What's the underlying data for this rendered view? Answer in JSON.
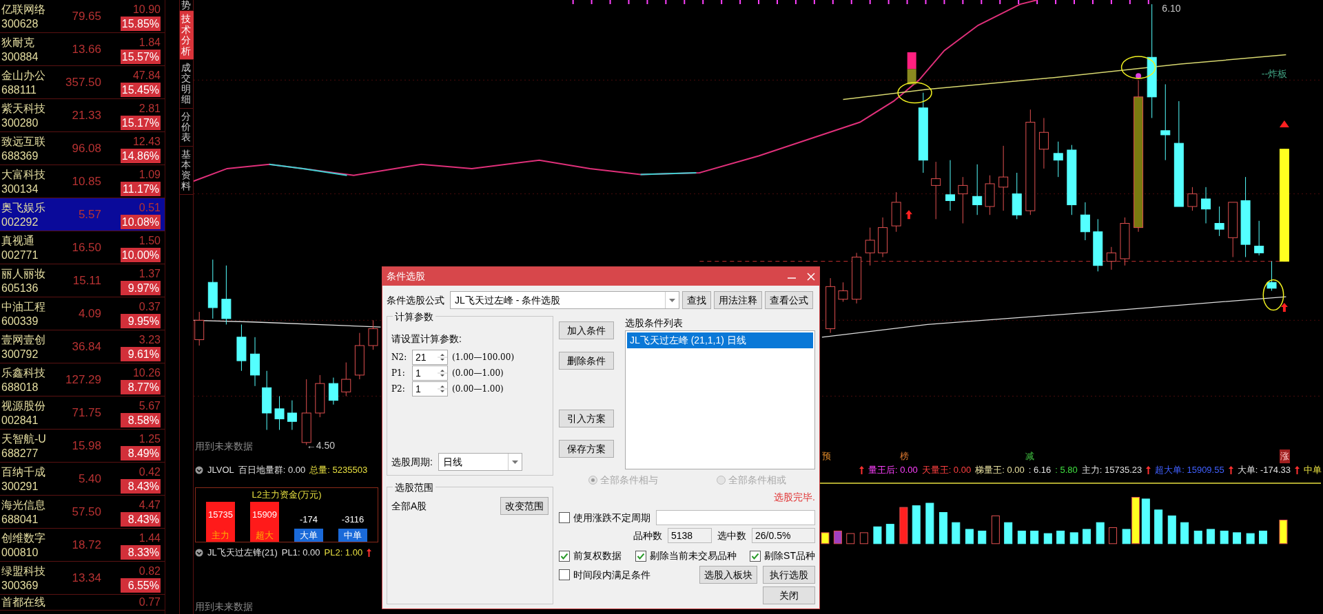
{
  "stock_list": [
    {
      "name": "亿联网络",
      "code": "300628",
      "price": "79.65",
      "change": "10.90",
      "change_pct": "15.85%",
      "selected": false
    },
    {
      "name": "狄耐克",
      "code": "300884",
      "price": "13.66",
      "change": "1.84",
      "change_pct": "15.57%",
      "selected": false
    },
    {
      "name": "金山办公",
      "code": "688111",
      "price": "357.50",
      "change": "47.84",
      "change_pct": "15.45%",
      "selected": false
    },
    {
      "name": "紫天科技",
      "code": "300280",
      "price": "21.33",
      "change": "2.81",
      "change_pct": "15.17%",
      "selected": false
    },
    {
      "name": "致远互联",
      "code": "688369",
      "price": "96.08",
      "change": "12.43",
      "change_pct": "14.86%",
      "selected": false
    },
    {
      "name": "大富科技",
      "code": "300134",
      "price": "10.85",
      "change": "1.09",
      "change_pct": "11.17%",
      "selected": false
    },
    {
      "name": "奥飞娱乐",
      "code": "002292",
      "price": "5.57",
      "change": "0.51",
      "change_pct": "10.08%",
      "selected": true
    },
    {
      "name": "真视通",
      "code": "002771",
      "price": "16.50",
      "change": "1.50",
      "change_pct": "10.00%",
      "selected": false
    },
    {
      "name": "丽人丽妆",
      "code": "605136",
      "price": "15.11",
      "change": "1.37",
      "change_pct": "9.97%",
      "selected": false
    },
    {
      "name": "中油工程",
      "code": "600339",
      "price": "4.09",
      "change": "0.37",
      "change_pct": "9.95%",
      "selected": false
    },
    {
      "name": "壹网壹创",
      "code": "300792",
      "price": "36.84",
      "change": "3.23",
      "change_pct": "9.61%",
      "selected": false
    },
    {
      "name": "乐鑫科技",
      "code": "688018",
      "price": "127.29",
      "change": "10.26",
      "change_pct": "8.77%",
      "selected": false
    },
    {
      "name": "视源股份",
      "code": "002841",
      "price": "71.75",
      "change": "5.67",
      "change_pct": "8.58%",
      "selected": false
    },
    {
      "name": "天智航-U",
      "code": "688277",
      "price": "15.98",
      "change": "1.25",
      "change_pct": "8.49%",
      "selected": false
    },
    {
      "name": "百纳千成",
      "code": "300291",
      "price": "5.40",
      "change": "0.42",
      "change_pct": "8.43%",
      "selected": false
    },
    {
      "name": "海光信息",
      "code": "688041",
      "price": "57.50",
      "change": "4.47",
      "change_pct": "8.43%",
      "selected": false
    },
    {
      "name": "创维数字",
      "code": "000810",
      "price": "18.72",
      "change": "1.44",
      "change_pct": "8.33%",
      "selected": false
    },
    {
      "name": "绿盟科技",
      "code": "300369",
      "price": "13.34",
      "change": "0.82",
      "change_pct": "6.55%",
      "selected": false
    },
    {
      "name": "首都在线",
      "change": "0.77",
      "selected": false
    }
  ],
  "side_tabs": [
    {
      "label": "势",
      "selected": false
    },
    {
      "label": "技术分析",
      "selected": true
    },
    {
      "label": "成交明细",
      "selected": false
    },
    {
      "label": "分价表",
      "selected": false
    },
    {
      "label": "基本资料",
      "selected": false
    }
  ],
  "price_chart": {
    "high_label": "6.10",
    "low_label": "←4.50",
    "signal_label": "--炸板",
    "note": "用到未来数据"
  },
  "markers": [
    {
      "label": "预",
      "color": "#e08a2a",
      "kind": "text"
    },
    {
      "label": "榜",
      "color": "#e07a30",
      "kind": "text"
    },
    {
      "label": "减",
      "color": "#40c040",
      "kind": "text"
    },
    {
      "label": "涨",
      "color": "#a02020",
      "kind": "tag"
    }
  ],
  "volume_indicator": {
    "name": "JLVOL",
    "left_values": [
      {
        "text": "百日地量群: 0.00",
        "color": "#e0e0e0"
      },
      {
        "text": "总量: 5235503",
        "color": "#e8e040"
      }
    ],
    "right_values": [
      {
        "text": "量王后: 0.00",
        "color": "#ff40ff",
        "arrow": true
      },
      {
        "text": "天量王: 0.00",
        "color": "#ff4040",
        "arrow": false
      },
      {
        "text": "梯量王: 0.00",
        "color": "#e8e0a0",
        "arrow": false
      },
      {
        "text": ": 6.16",
        "color": "#e0e0e0",
        "arrow": false
      },
      {
        "text": ": 5.80",
        "color": "#40e040",
        "arrow": false
      },
      {
        "text": "主力: 15735.23",
        "color": "#e0e0e0",
        "arrow": false
      },
      {
        "text": "超大单: 15909.55",
        "color": "#4060ff",
        "arrow": true
      },
      {
        "text": "大单: -174.33",
        "color": "#e0e0e0",
        "arrow": true
      },
      {
        "text": "中单",
        "color": "#e8e040",
        "arrow": true
      }
    ]
  },
  "l2_panel": {
    "title": "L2主力资金(万元)",
    "bars": [
      {
        "value": "15735",
        "label": "主力",
        "kind": "positive"
      },
      {
        "value": "15909",
        "label": "超大",
        "kind": "positive"
      },
      {
        "value": "-174",
        "label": "大单",
        "kind": "negative"
      },
      {
        "value": "-3116",
        "label": "中单",
        "kind": "negative"
      }
    ]
  },
  "second_indicator": {
    "name": "JL飞天过左锋(21)",
    "values": [
      {
        "text": "PL1: 0.00",
        "color": "#e0e0e0",
        "arrow": false
      },
      {
        "text": "PL2: 1.00",
        "color": "#e8e040",
        "arrow": true
      }
    ],
    "note": "用到未来数据"
  },
  "dialog": {
    "title": "条件选股",
    "formula": {
      "label": "条件选股公式",
      "value": "JL飞天过左峰 - 条件选股"
    },
    "top_buttons": [
      "查找",
      "用法注释",
      "查看公式"
    ],
    "params": {
      "title": "计算参数",
      "prompt": "请设置计算参数:",
      "rows": [
        {
          "name": "N2:",
          "value": "21",
          "range": "(1.00—100.00)"
        },
        {
          "name": "P1:",
          "value": "1",
          "range": "(0.00—1.00)"
        },
        {
          "name": "P2:",
          "value": "1",
          "range": "(0.00—1.00)"
        }
      ]
    },
    "period": {
      "label": "选股周期:",
      "value": "日线"
    },
    "scope": {
      "title": "选股范围",
      "value": "全部A股",
      "button": "改变范围"
    },
    "action_buttons": [
      "加入条件",
      "删除条件",
      "引入方案",
      "保存方案"
    ],
    "conditions": {
      "title": "选股条件列表",
      "items": [
        {
          "text": "JL飞天过左峰 (21,1,1) 日线",
          "selected": true
        }
      ]
    },
    "combine": [
      {
        "label": "全部条件相与",
        "selected": true,
        "disabled": true
      },
      {
        "label": "全部条件相或",
        "selected": false,
        "disabled": true
      }
    ],
    "status": "选股完毕.",
    "variable_period": {
      "label": "使用涨跌不定周期",
      "checked": false
    },
    "counts": [
      {
        "label": "品种数",
        "value": "5138"
      },
      {
        "label": "选中数",
        "value": "26/0.5%"
      }
    ],
    "options": [
      {
        "label": "前复权数据",
        "checked": true
      },
      {
        "label": "剔除当前未交易品种",
        "checked": true
      },
      {
        "label": "剔除ST品种",
        "checked": true
      }
    ],
    "time_option": {
      "label": "时间段内满足条件",
      "checked": false
    },
    "bottom_buttons": [
      "选股入板块",
      "执行选股",
      "关闭"
    ]
  }
}
